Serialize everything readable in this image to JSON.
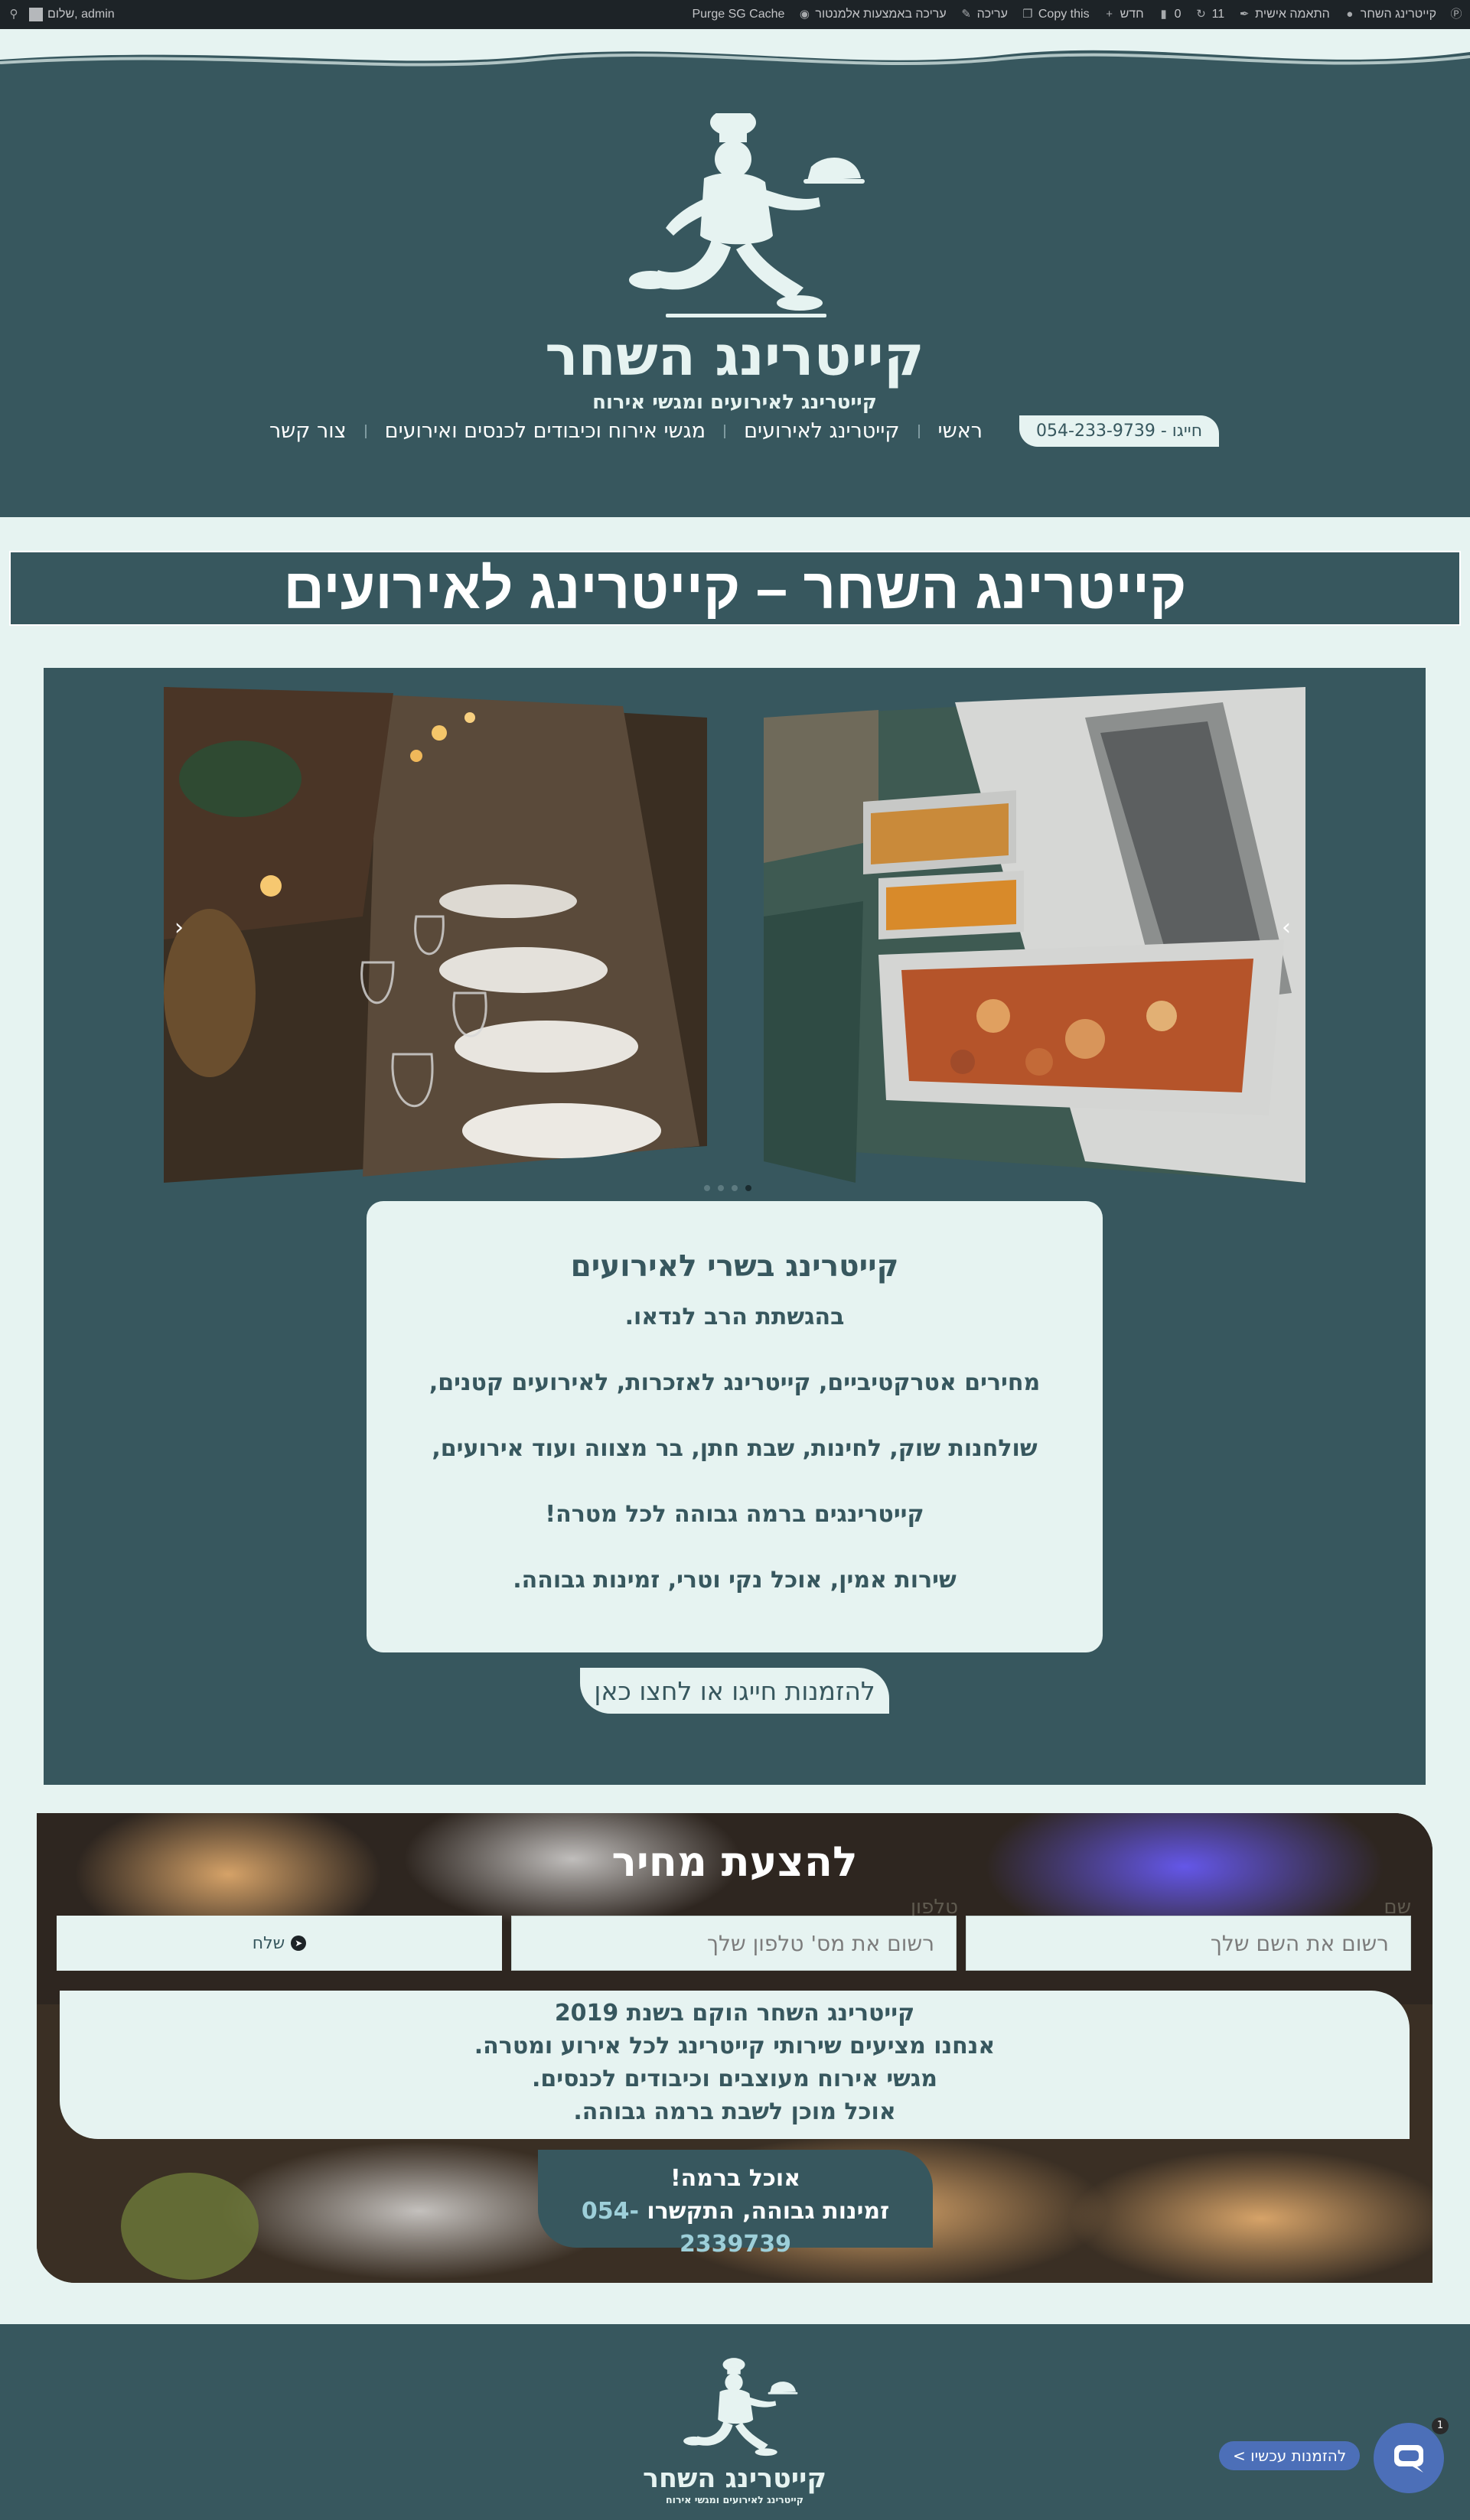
{
  "admin_bar": {
    "site_name": "קייטרינג השחר",
    "customize": "התאמה אישית",
    "updates_count": "11",
    "comments_count": "0",
    "new": "חדש",
    "copy_this": "Copy this",
    "edit": "עריכה",
    "edit_elementor": "עריכה באמצעות אלמנטור",
    "purge_cache": "Purge SG Cache",
    "greeting": "שלום, admin"
  },
  "header": {
    "logo_title": "קייטרינג השחר",
    "logo_tagline": "קייטרינג לאירועים ומגשי אירוח",
    "nav": {
      "phone": "חייגו - 054-233-9739",
      "items": [
        "ראשי",
        "קייטרינג לאירועים",
        "מגשי אירוח וכיבודים לכנסים ואירועים",
        "צור קשר"
      ]
    }
  },
  "page_title": "קייטרינג השחר – קייטרינג לאירועים",
  "slider": {
    "prev_arrow": "‹",
    "next_arrow": "›",
    "slides_count": 4,
    "active_slide": 4
  },
  "info_box": {
    "heading": "קייטרינג בשרי לאירועים",
    "lines": [
      "בהגשתת הרב לנדאו.",
      "מחירים אטרקטיביים, קייטרינג לאזכרות, לאירועים קטנים,",
      "שולחנות שוק, לחינות, שבת חתן, בר מצווה ועוד אירועים,",
      "קייטרינגים ברמה גבוהה לכל מטרה!",
      "שירות אמין, אוכל נקי וטרי, זמינות גבוהה."
    ],
    "order_button": "להזמנות חייגו או לחצו כאן"
  },
  "quote": {
    "title": "להצעת מחיר",
    "name_label": "שם",
    "name_placeholder": "רשום את השם שלך",
    "phone_label": "טלפון",
    "phone_placeholder": "רשום את מס' טלפון שלך",
    "send_label": "שלח",
    "about_lines": [
      "קייטרינג השחר הוקם בשנת 2019",
      "אנחנו מציעים שירותי קייטרינג לכל אירוע ומטרה.",
      "מגשי אירוח מעוצבים וכיבודים לכנסים.",
      "אוכל מוכן לשבת ברמה גבוהה."
    ],
    "contact_line1": "אוכל ברמה!",
    "contact_line2": "זמינות גבוהה, התקשרו",
    "contact_phone": "054-2339739"
  },
  "floating": {
    "chat_label": "להזמנות עכשיו >",
    "badge": "1"
  },
  "colors": {
    "primary": "#37575e",
    "light": "#e6f3f1",
    "admin_bar": "#1d2327",
    "whatsapp": "#4c6fb8"
  }
}
